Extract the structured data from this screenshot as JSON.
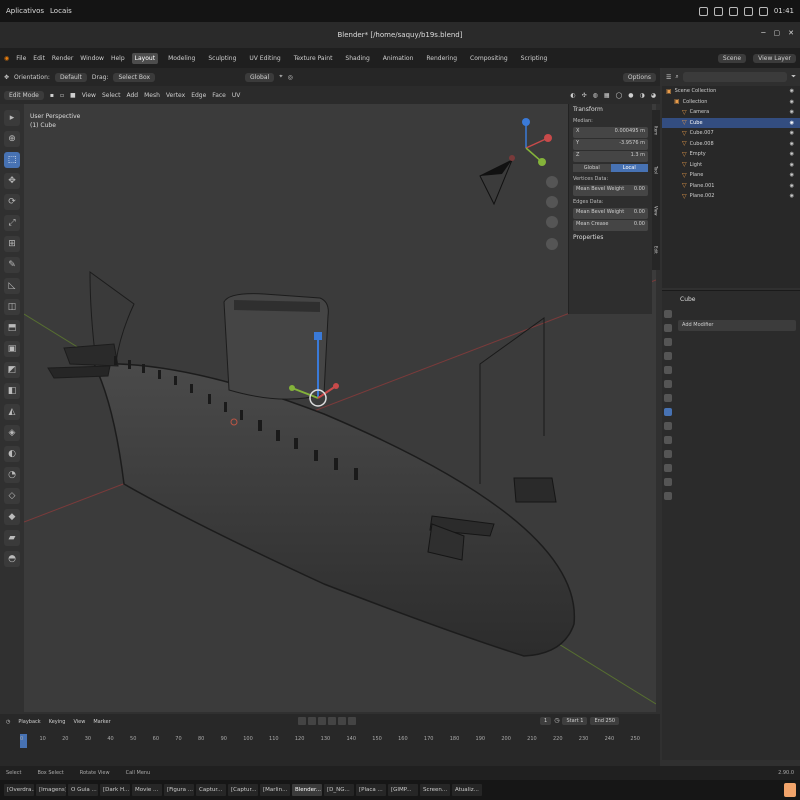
{
  "os_bar": {
    "apps_label": "Aplicativos",
    "places_label": "Locais",
    "time": "01:41"
  },
  "window": {
    "title": "Blender* [/home/saquy/b19s.blend]"
  },
  "menu": {
    "items": [
      "File",
      "Edit",
      "Render",
      "Window",
      "Help"
    ],
    "workspaces": [
      "Layout",
      "Modeling",
      "Sculpting",
      "UV Editing",
      "Texture Paint",
      "Shading",
      "Animation",
      "Rendering",
      "Compositing",
      "Scripting"
    ],
    "active_workspace": "Layout",
    "scene": "Scene",
    "view_layer": "View Layer"
  },
  "header": {
    "orientation_label": "Orientation:",
    "orientation_value": "Default",
    "drag_label": "Drag:",
    "drag_value": "Select Box",
    "transform": "Global",
    "options": "Options",
    "mode": "Edit Mode",
    "menus": [
      "View",
      "Select",
      "Add",
      "Mesh",
      "Vertex",
      "Edge",
      "Face",
      "UV"
    ]
  },
  "viewport": {
    "view_name": "User Perspective",
    "object_name": "(1) Cube"
  },
  "n_panel": {
    "title": "Transform",
    "median_label": "Median:",
    "x_label": "X",
    "x_value": "0.000495 m",
    "y_label": "Y",
    "y_value": "-3.9576 m",
    "z_label": "Z",
    "z_value": "1.3 m",
    "global": "Global",
    "local": "Local",
    "vertex_data": "Vertices Data:",
    "mean_bevel_weight_label": "Mean Bevel Weight",
    "mean_bevel_weight_value": "0.00",
    "edge_data": "Edges Data:",
    "edge_bevel_label": "Mean Bevel Weight",
    "edge_bevel_value": "0.00",
    "mean_crease_label": "Mean Crease",
    "mean_crease_value": "0.00",
    "properties": "Properties",
    "side_tabs": [
      "Item",
      "Tool",
      "View",
      "Edit"
    ]
  },
  "outliner": {
    "rows": [
      {
        "label": "Scene Collection",
        "selected": false,
        "indent": 0
      },
      {
        "label": "Collection",
        "selected": false,
        "indent": 1
      },
      {
        "label": "Camera",
        "selected": false,
        "indent": 2
      },
      {
        "label": "Cube",
        "selected": true,
        "indent": 2
      },
      {
        "label": "Cube.007",
        "selected": false,
        "indent": 2
      },
      {
        "label": "Cube.008",
        "selected": false,
        "indent": 2
      },
      {
        "label": "Empty",
        "selected": false,
        "indent": 2
      },
      {
        "label": "Light",
        "selected": false,
        "indent": 2
      },
      {
        "label": "Plane",
        "selected": false,
        "indent": 2
      },
      {
        "label": "Plane.001",
        "selected": false,
        "indent": 2
      },
      {
        "label": "Plane.002",
        "selected": false,
        "indent": 2
      }
    ]
  },
  "properties": {
    "object": "Cube",
    "add_modifier": "Add Modifier"
  },
  "timeline": {
    "menus": [
      "Playback",
      "Keying",
      "View",
      "Marker"
    ],
    "ticks": [
      "0",
      "10",
      "20",
      "30",
      "40",
      "50",
      "60",
      "70",
      "80",
      "90",
      "100",
      "110",
      "120",
      "130",
      "140",
      "150",
      "160",
      "170",
      "180",
      "190",
      "200",
      "210",
      "220",
      "230",
      "240",
      "250"
    ],
    "current_frame": "1",
    "start_label": "Start",
    "start": "1",
    "end_label": "End",
    "end": "250"
  },
  "status_bar": {
    "items": [
      "Select",
      "Box Select",
      "Rotate View",
      "Call Menu"
    ],
    "version": "2.90.0"
  },
  "taskbar": {
    "items": [
      "[Overdra...",
      "[Imagens]",
      "O Guia ...",
      "[Dark H...",
      "Movie ...",
      "[Figura ...",
      "Captur...",
      "[Captur...",
      "[Marlin...",
      "Blender...",
      "[D_NG...",
      "[Placa ...",
      "[GIMP...",
      "Screen...",
      "Atualiz..."
    ],
    "active_index": 9
  },
  "colors": {
    "accent": "#4772b3",
    "selection": "#334d80",
    "axis_x": "#c84a4a",
    "axis_y": "#84b33a",
    "axis_z": "#3a7ad8"
  }
}
